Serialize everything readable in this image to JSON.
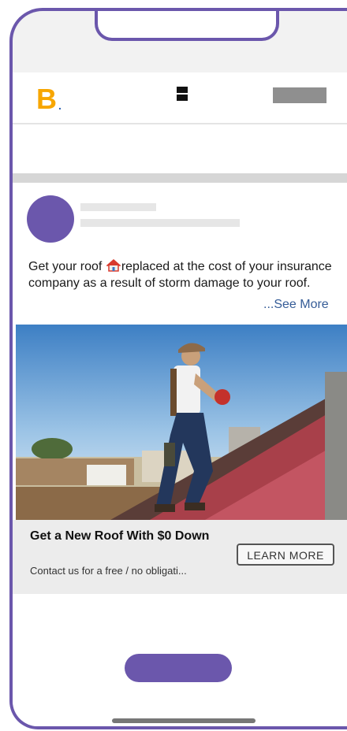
{
  "header": {
    "logo_letter": "B",
    "logo_dot": ".",
    "menu_icon": "menu-icon",
    "brand_color": "#f7a600"
  },
  "post": {
    "text_before_icon": "Get your roof ",
    "inline_icon": "house-icon",
    "text_after_icon": "replaced at the cost of your insurance company as a result of storm damage to your roof.",
    "see_more_label": "...See More",
    "image_icon": "roofer-photo"
  },
  "ad": {
    "headline": "Get a New Roof With $0 Down",
    "description": "Contact us for a free / no obligati...",
    "cta_label": "LEARN MORE"
  },
  "theme": {
    "accent": "#6b57ac",
    "link": "#355c97"
  }
}
